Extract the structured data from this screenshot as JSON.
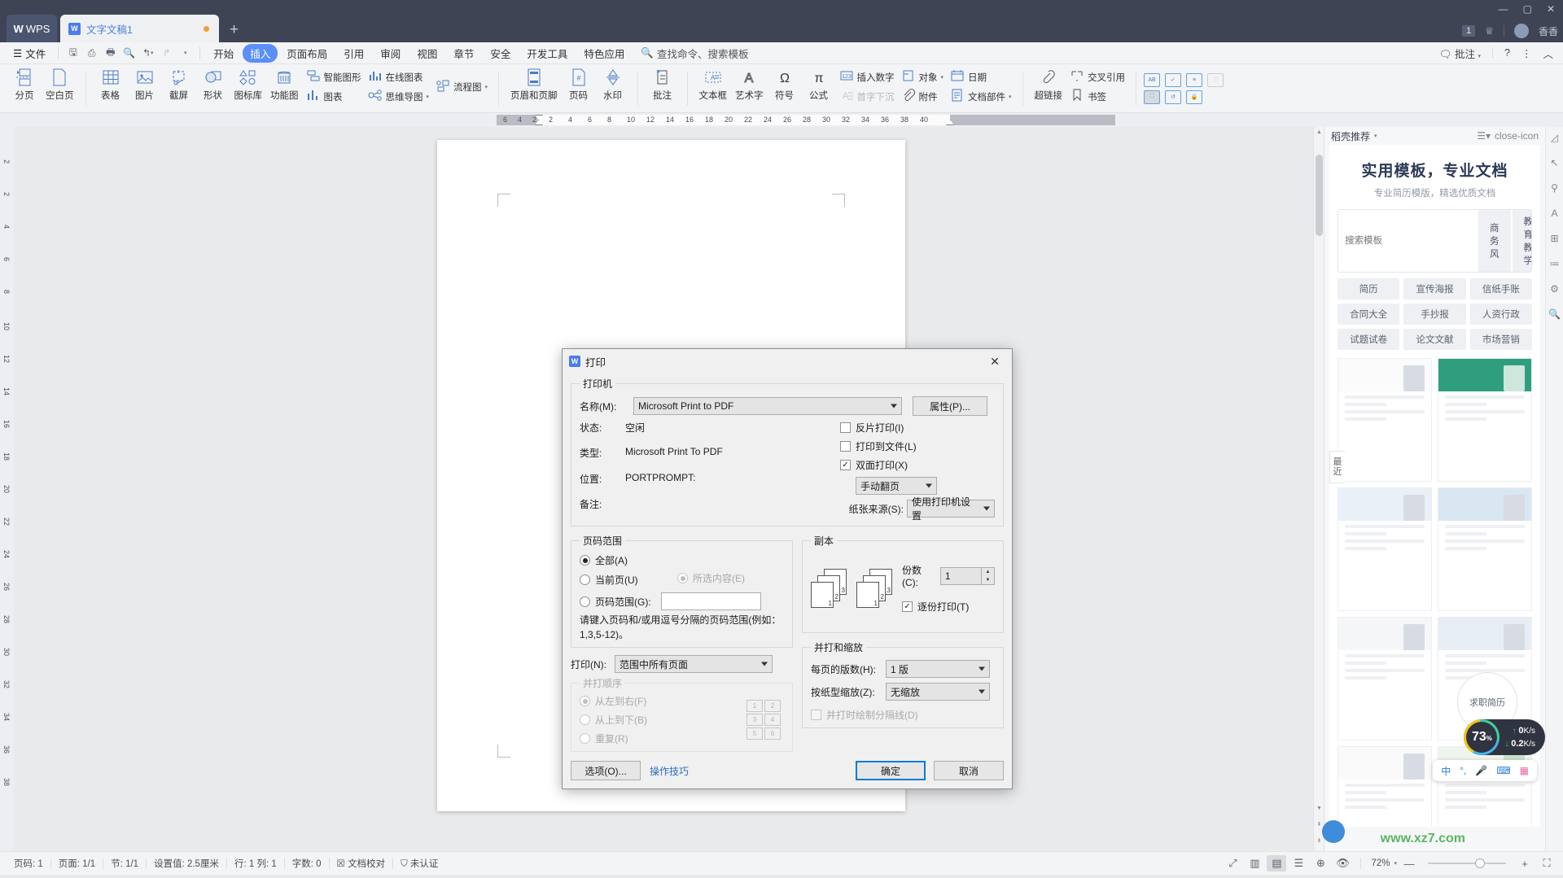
{
  "titlebar": {
    "wps_label": "WPS",
    "doc_tab": "文字文稿1",
    "plus": "+",
    "count_badge": "1",
    "user_name": "香香",
    "min": "—",
    "max": "▢",
    "close": "✕"
  },
  "menubar": {
    "file": "文件",
    "quick_access": [
      "save-icon",
      "undo-print-icon",
      "print-icon",
      "print-preview-icon",
      "undo-icon",
      "redo-icon",
      "customize-icon"
    ],
    "tabs": [
      {
        "label": "开始",
        "active": false
      },
      {
        "label": "插入",
        "active": true
      },
      {
        "label": "页面布局",
        "active": false
      },
      {
        "label": "引用",
        "active": false
      },
      {
        "label": "审阅",
        "active": false
      },
      {
        "label": "视图",
        "active": false
      },
      {
        "label": "章节",
        "active": false
      },
      {
        "label": "安全",
        "active": false
      },
      {
        "label": "开发工具",
        "active": false
      },
      {
        "label": "特色应用",
        "active": false
      }
    ],
    "search": "查找命令、搜索模板",
    "comment": "批注",
    "help": "?",
    "more": "⋮",
    "collapse": "︿"
  },
  "ribbon": {
    "groups": [
      {
        "items": [
          {
            "label": "分页",
            "icon": "page-break-icon",
            "caret": true
          },
          {
            "label": "空白页",
            "icon": "blank-page-icon",
            "caret": true
          }
        ]
      },
      {
        "items": [
          {
            "label": "表格",
            "icon": "table-icon",
            "caret": true
          },
          {
            "label": "图片",
            "icon": "picture-icon",
            "caret": true
          },
          {
            "label": "截屏",
            "icon": "screenshot-icon",
            "caret": true
          },
          {
            "label": "形状",
            "icon": "shapes-icon",
            "caret": true
          },
          {
            "label": "图标库",
            "icon": "icon-library-icon",
            "caret": false
          },
          {
            "label": "功能图",
            "icon": "function-chart-icon",
            "caret": true
          }
        ],
        "stacks": [
          {
            "rows": [
              {
                "label": "智能图形",
                "icon": "smart-art-icon",
                "caret": false
              },
              {
                "label": "图表",
                "icon": "chart-icon",
                "caret": false
              }
            ]
          },
          {
            "rows": [
              {
                "label": "在线图表",
                "icon": "online-chart-icon",
                "caret": false
              },
              {
                "label": "思维导图",
                "icon": "mind-map-icon",
                "caret": true
              }
            ]
          },
          {
            "rows": [
              {
                "label": "流程图",
                "icon": "flowchart-icon",
                "caret": true
              }
            ]
          }
        ]
      },
      {
        "items": [
          {
            "label": "页眉和页脚",
            "icon": "header-footer-icon",
            "caret": false
          },
          {
            "label": "页码",
            "icon": "page-number-icon",
            "caret": true
          },
          {
            "label": "水印",
            "icon": "watermark-icon",
            "caret": true
          }
        ]
      },
      {
        "items": [
          {
            "label": "批注",
            "icon": "comment-icon",
            "caret": false
          }
        ]
      },
      {
        "items": [
          {
            "label": "文本框",
            "icon": "text-box-icon",
            "caret": true
          },
          {
            "label": "艺术字",
            "icon": "word-art-icon",
            "caret": true
          },
          {
            "label": "符号",
            "icon": "symbol-icon",
            "caret": true
          },
          {
            "label": "公式",
            "icon": "formula-icon",
            "caret": false
          }
        ],
        "stacks": [
          {
            "rows": [
              {
                "label": "插入数字",
                "icon": "insert-number-icon",
                "caret": false
              },
              {
                "label": "首字下沉",
                "icon": "drop-cap-icon",
                "caret": false,
                "disabled": true
              }
            ]
          },
          {
            "rows": [
              {
                "label": "对象",
                "icon": "object-icon",
                "caret": true
              },
              {
                "label": "附件",
                "icon": "attachment-icon",
                "caret": false
              }
            ]
          },
          {
            "rows": [
              {
                "label": "日期",
                "icon": "date-icon",
                "caret": false
              },
              {
                "label": "文档部件",
                "icon": "doc-parts-icon",
                "caret": true
              }
            ]
          }
        ]
      },
      {
        "items": [
          {
            "label": "超链接",
            "icon": "hyperlink-icon",
            "caret": true
          }
        ],
        "stacks": [
          {
            "rows": [
              {
                "label": "交叉引用",
                "icon": "cross-reference-icon",
                "caret": false
              },
              {
                "label": "书签",
                "icon": "bookmark-icon",
                "caret": false
              }
            ]
          }
        ]
      }
    ],
    "form_icons_row1": [
      "text-field-icon",
      "checkbox-field-icon",
      "dropdown-field-icon",
      "info-field-icon"
    ],
    "form_icons_row2": [
      "form-frame-icon",
      "form-reset-icon",
      "form-protect-icon"
    ]
  },
  "ruler": {
    "h_left_numbers": [
      "6",
      "4",
      "2"
    ],
    "h_numbers": [
      "2",
      "4",
      "6",
      "8",
      "10",
      "12",
      "14",
      "16",
      "18",
      "20",
      "22",
      "24",
      "26",
      "28",
      "30",
      "32",
      "34",
      "36",
      "38",
      "40"
    ],
    "v_numbers": [
      "2",
      "2",
      "4",
      "6",
      "8",
      "10",
      "12",
      "14",
      "16",
      "18",
      "20",
      "22",
      "24",
      "26",
      "28",
      "30",
      "32",
      "34",
      "36",
      "38"
    ]
  },
  "taskpane": {
    "header": "稻壳推荐",
    "header_caret": "▾",
    "menu_icon": "list-menu-icon",
    "close_icon": "close-icon",
    "title": "实用模板，专业文档",
    "subtitle": "专业简历模版，精选优质文档",
    "search_placeholder": "搜索模板",
    "search_chips": [
      "商务风",
      "教育教学"
    ],
    "tags": [
      "简历",
      "宣传海报",
      "信纸手账",
      "合同大全",
      "手抄报",
      "人资行政",
      "试题试卷",
      "论文文献",
      "市场营销"
    ],
    "recent_label": "最近"
  },
  "sidebar_icons": [
    "shapes-icon",
    "pointer-icon",
    "person-icon",
    "text-style-icon",
    "table-icon",
    "outline-icon",
    "settings-icon",
    "search-icon"
  ],
  "print_dialog": {
    "title": "打印",
    "close": "✕",
    "printer_group": "打印机",
    "name_label": "名称(M):",
    "name_value": "Microsoft Print to PDF",
    "properties_btn": "属性(P)...",
    "info_rows": [
      {
        "label": "状态:",
        "value": "空闲"
      },
      {
        "label": "类型:",
        "value": "Microsoft Print To PDF"
      },
      {
        "label": "位置:",
        "value": "PORTPROMPT:"
      },
      {
        "label": "备注:",
        "value": ""
      }
    ],
    "reverse_print": {
      "label": "反片打印(I)",
      "checked": false
    },
    "print_to_file": {
      "label": "打印到文件(L)",
      "checked": false
    },
    "duplex": {
      "label": "双面打印(X)",
      "checked": true
    },
    "duplex_mode": "手动翻页",
    "paper_source_label": "纸张来源(S):",
    "paper_source_value": "使用打印机设置",
    "page_range_group": "页码范围",
    "range_all": {
      "label": "全部(A)",
      "selected": true
    },
    "range_current": {
      "label": "当前页(U)",
      "selected": false
    },
    "range_selection": {
      "label": "所选内容(E)",
      "selected": false,
      "disabled": true
    },
    "range_pages": {
      "label": "页码范围(G):",
      "selected": false,
      "value": ""
    },
    "range_hint": "请键入页码和/或用逗号分隔的页码范围(例如：1,3,5-12)。",
    "print_what_label": "打印(N):",
    "print_what_value": "范围中所有页面",
    "order_group": "并打顺序",
    "order_options": [
      {
        "label": "从左到右(F)",
        "selected": true
      },
      {
        "label": "从上到下(B)",
        "selected": false
      },
      {
        "label": "重复(R)",
        "selected": false
      }
    ],
    "order_preview": [
      "1",
      "2",
      "3",
      "4",
      "5",
      "6"
    ],
    "copies_group": "副本",
    "copies_label": "份数(C):",
    "copies_value": "1",
    "collate": {
      "label": "逐份打印(T)",
      "checked": true
    },
    "zoom_group": "并打和缩放",
    "pages_per_sheet_label": "每页的版数(H):",
    "pages_per_sheet_value": "1 版",
    "scale_label": "按纸型缩放(Z):",
    "scale_value": "无缩放",
    "draw_separator": {
      "label": "并打时绘制分隔线(D)",
      "checked": false,
      "disabled": true
    },
    "options_btn": "选项(O)...",
    "tips_link": "操作技巧",
    "ok_btn": "确定",
    "cancel_btn": "取消"
  },
  "statusbar": {
    "items": [
      "页码: 1",
      "页面: 1/1",
      "节: 1/1",
      "设置值: 2.5厘米",
      "行: 1   列: 1",
      "字数: 0"
    ],
    "proof": "文档校对",
    "unverified": "未认证",
    "view_icons": [
      "fullscreen-icon",
      "two-page-icon",
      "print-layout-icon",
      "outline-view-icon",
      "web-layout-icon",
      "eye-icon"
    ],
    "zoom_value": "72%",
    "zoom_caret": "▾",
    "minus": "—",
    "plus": "+",
    "fit_icon": "fit-page-icon"
  },
  "float_widgets": {
    "net_percent": "73",
    "net_percent_unit": "%",
    "upload": "0",
    "upload_unit": "K/s",
    "download": "0.2",
    "download_unit": "K/s",
    "ime": [
      "中",
      "°,",
      "mic-icon",
      "keyboard-icon",
      "apps-icon"
    ],
    "watermark": "www.xz7.com",
    "resume_badge": "求职简历"
  }
}
